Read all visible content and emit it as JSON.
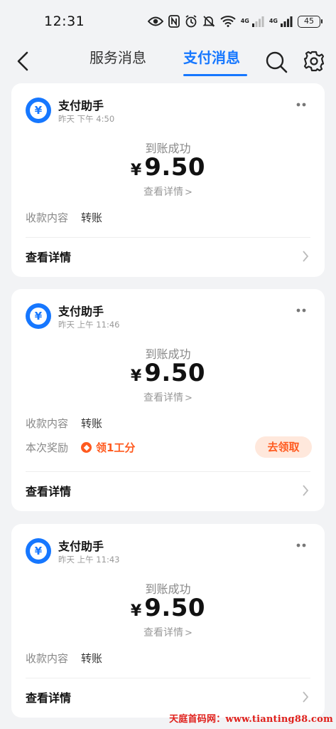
{
  "status_bar": {
    "time": "12:31",
    "signal_label_1": "4G",
    "signal_label_2": "4G",
    "battery": "45"
  },
  "header": {
    "tabs": [
      {
        "label": "服务消息",
        "active": false
      },
      {
        "label": "支付消息",
        "active": true
      }
    ]
  },
  "colors": {
    "accent": "#1677ff",
    "reward": "#ff5a1f",
    "background": "#f2f3f5"
  },
  "messages": [
    {
      "sender": "支付助手",
      "time": "昨天 下午 4:50",
      "status": "到账成功",
      "currency": "¥",
      "amount": "9.50",
      "detail_link": "查看详情",
      "content_label": "收款内容",
      "content_value": "转账",
      "footer_label": "查看详情"
    },
    {
      "sender": "支付助手",
      "time": "昨天 上午 11:46",
      "status": "到账成功",
      "currency": "¥",
      "amount": "9.50",
      "detail_link": "查看详情",
      "content_label": "收款内容",
      "content_value": "转账",
      "reward_label": "本次奖励",
      "reward_value": "领1工分",
      "reward_button": "去领取",
      "footer_label": "查看详情"
    },
    {
      "sender": "支付助手",
      "time": "昨天 上午 11:43",
      "status": "到账成功",
      "currency": "¥",
      "amount": "9.50",
      "detail_link": "查看详情",
      "content_label": "收款内容",
      "content_value": "转账",
      "footer_label": "查看详情"
    }
  ],
  "watermark": "天庭首码网：www.tianting88.com",
  "icons": [
    "back-arrow-icon",
    "search-icon",
    "settings-gear-icon",
    "more-dots-icon",
    "yuan-icon",
    "chevron-right-icon"
  ]
}
